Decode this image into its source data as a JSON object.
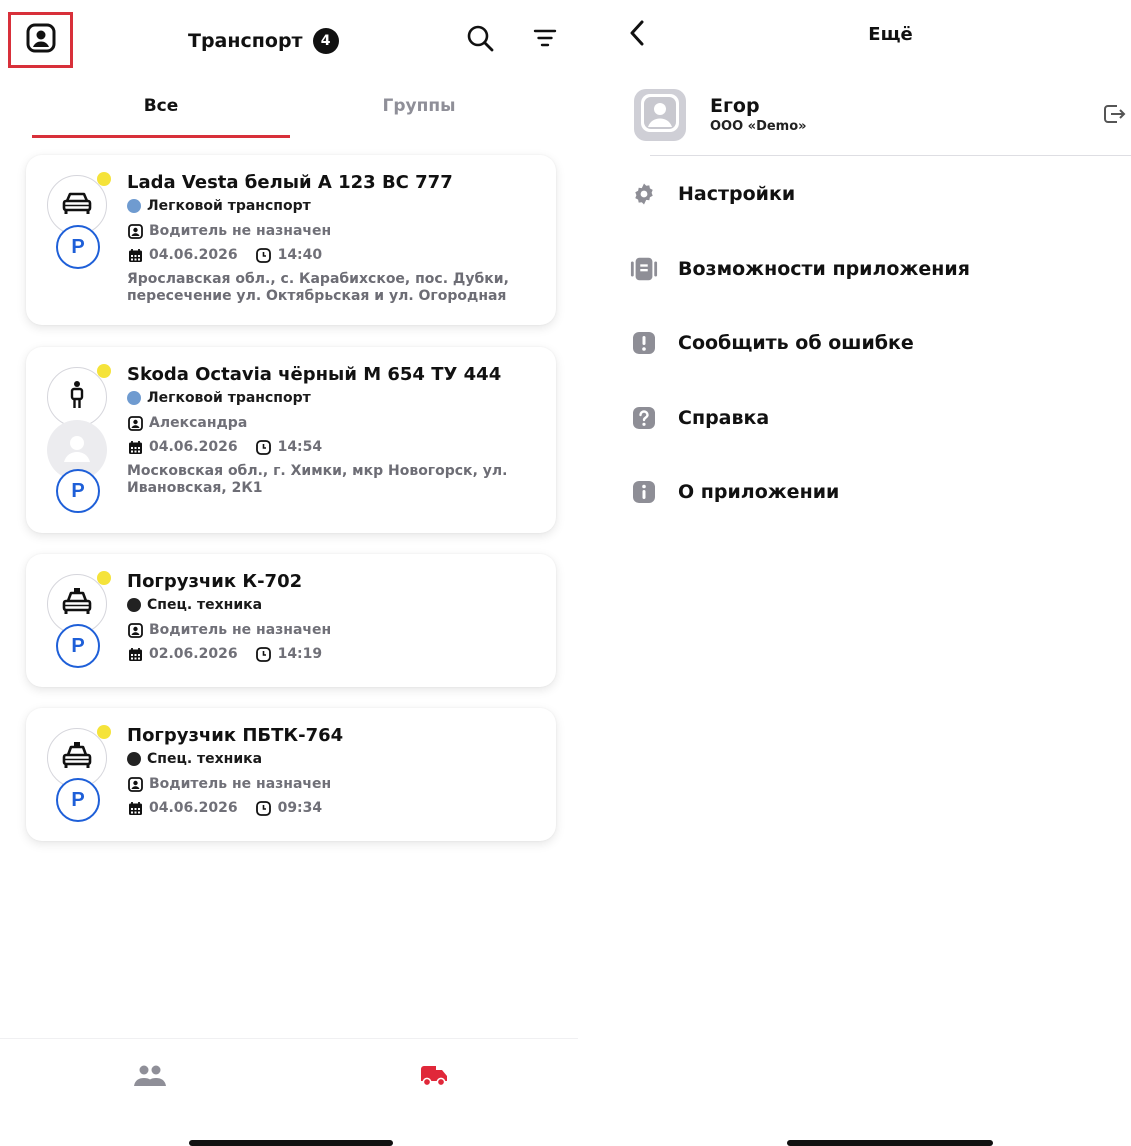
{
  "left": {
    "header": {
      "title": "Транспорт",
      "count": "4"
    },
    "tabs": [
      {
        "label": "Все",
        "active": true
      },
      {
        "label": "Группы",
        "active": false
      }
    ],
    "vehicles": [
      {
        "name": "Lada Vesta белый А 123 ВС 777",
        "category": "Легковой транспорт",
        "category_color": "#6f9bd0",
        "driver": "Водитель не назначен",
        "date": "04.06.2026",
        "time": "14:40",
        "address": "Ярославская обл., с. Карабихское, пос. Дубки, пересечение ул. Октябрьская и ул. Огородная",
        "status_icon": "car-icon",
        "parking": "P"
      },
      {
        "name": "Skoda Octavia чёрный М 654 ТУ 444",
        "category": "Легковой транспорт",
        "category_color": "#6f9bd0",
        "driver": "Александра",
        "date": "04.06.2026",
        "time": "14:54",
        "address": "Московская обл., г. Химки, мкр Новогорск, ул. Ивановская, 2К1",
        "status_icon": "person-walking-icon",
        "parking": "P"
      },
      {
        "name": "Погрузчик К-702",
        "category": "Спец. техника",
        "category_color": "#222222",
        "driver": "Водитель не назначен",
        "date": "02.06.2026",
        "time": "14:19",
        "status_icon": "taxi-icon",
        "parking": "P"
      },
      {
        "name": "Погрузчик ПБТК-764",
        "category": "Спец. техника",
        "category_color": "#222222",
        "driver": "Водитель не назначен",
        "date": "04.06.2026",
        "time": "09:34",
        "status_icon": "taxi-icon",
        "parking": "P"
      }
    ],
    "bottom_nav": [
      {
        "icon": "users-icon",
        "active": false
      },
      {
        "icon": "truck-icon",
        "active": true
      }
    ]
  },
  "right": {
    "title": "Ещё",
    "user": {
      "name": "Егор",
      "org": "ООО «Demo»"
    },
    "menu": [
      {
        "label": "Настройки",
        "icon": "gear-icon"
      },
      {
        "label": "Возможности приложения",
        "icon": "app-features-icon"
      },
      {
        "label": "Сообщить об ошибке",
        "icon": "alert-icon"
      },
      {
        "label": "Справка",
        "icon": "help-icon"
      },
      {
        "label": "О приложении",
        "icon": "info-icon"
      }
    ]
  },
  "colors": {
    "accent": "#d8303a",
    "parking_blue": "#1e5fd8",
    "online_dot": "#f5e33a",
    "muted": "#707078"
  }
}
